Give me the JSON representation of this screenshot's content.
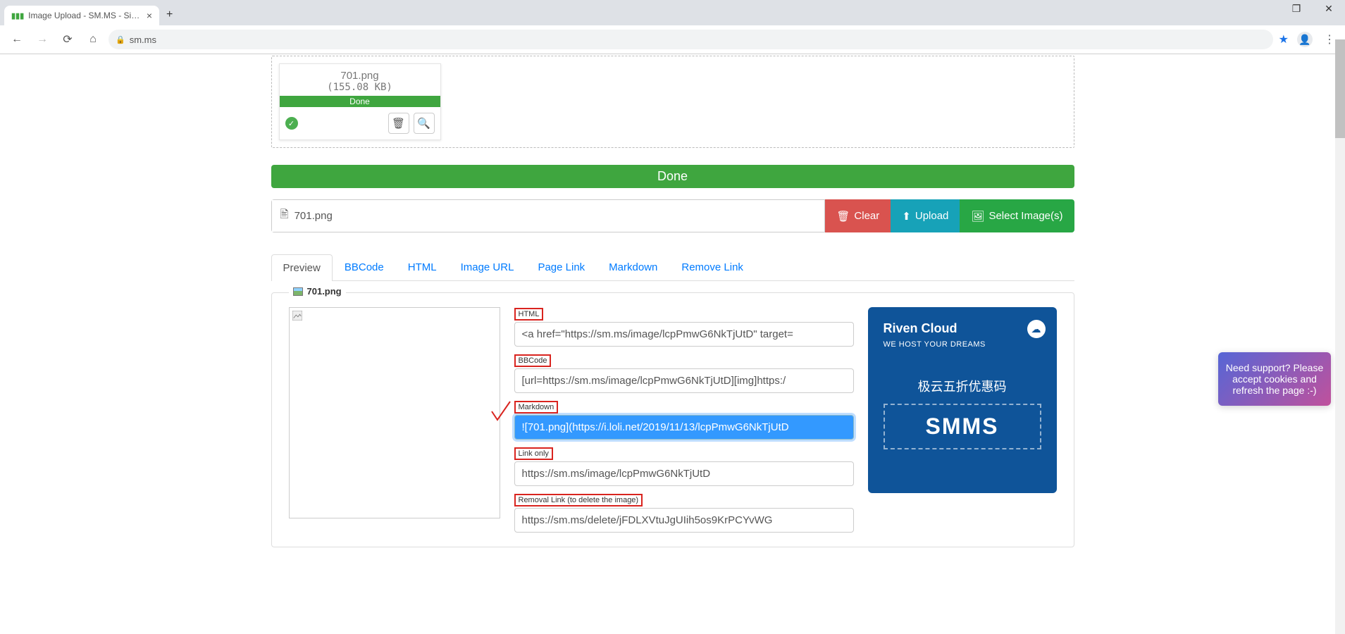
{
  "browser": {
    "tab_title": "Image Upload - SM.MS - Simp",
    "url_host": "sm.ms"
  },
  "upload_card": {
    "filename": "701.png",
    "filesize": "(155.08 KB)",
    "progress": "Done"
  },
  "done_bar": "Done",
  "input_bar": {
    "filename": "701.png"
  },
  "buttons": {
    "clear": "Clear",
    "upload": "Upload",
    "select": "Select Image(s)"
  },
  "tabs": {
    "preview": "Preview",
    "bbcode": "BBCode",
    "html": "HTML",
    "image_url": "Image URL",
    "page_link": "Page Link",
    "markdown": "Markdown",
    "remove_link": "Remove Link"
  },
  "legend_filename": "701.png",
  "fields": {
    "html": {
      "label": "HTML",
      "value": "<a href=\"https://sm.ms/image/lcpPmwG6NkTjUtD\" target="
    },
    "bbcode": {
      "label": "BBCode",
      "value": "[url=https://sm.ms/image/lcpPmwG6NkTjUtD][img]https:/"
    },
    "markdown": {
      "label": "Markdown",
      "value": "![701.png](https://i.loli.net/2019/11/13/lcpPmwG6NkTjUtD"
    },
    "link_only": {
      "label": "Link only",
      "value": "https://sm.ms/image/lcpPmwG6NkTjUtD"
    },
    "removal": {
      "label": "Removal Link (to delete the image)",
      "value": "https://sm.ms/delete/jFDLXVtuJgUIih5os9KrPCYvWG"
    }
  },
  "ad": {
    "title": "Riven Cloud",
    "subtitle": "WE HOST YOUR DREAMS",
    "promo": "极云五折优惠码",
    "code": "SMMS"
  },
  "support": "Need support? Please accept cookies and refresh the page :-)"
}
